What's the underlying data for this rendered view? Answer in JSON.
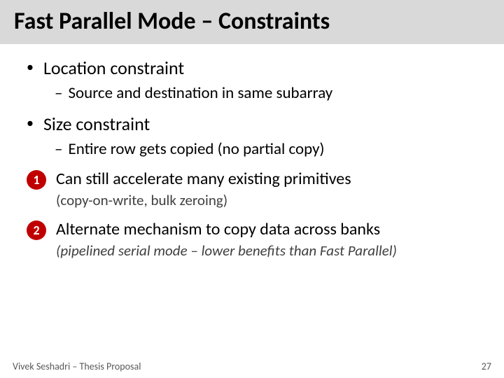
{
  "title": "Fast Parallel Mode – Constraints",
  "bullets": [
    {
      "main": "Location constraint",
      "sub": "Source and destination in same subarray"
    },
    {
      "main": "Size constraint",
      "sub": "Entire row gets copied (no partial copy)"
    }
  ],
  "numbered": [
    {
      "num": "1",
      "main": "Can still accelerate many existing primitives",
      "sub": "(copy-on-write, bulk zeroing)"
    },
    {
      "num": "2",
      "main": "Alternate mechanism to copy data across banks",
      "sub": "(pipelined serial mode – lower benefits than Fast Parallel)"
    }
  ],
  "footer": {
    "left": "Vivek Seshadri – Thesis Proposal",
    "right": "27"
  }
}
